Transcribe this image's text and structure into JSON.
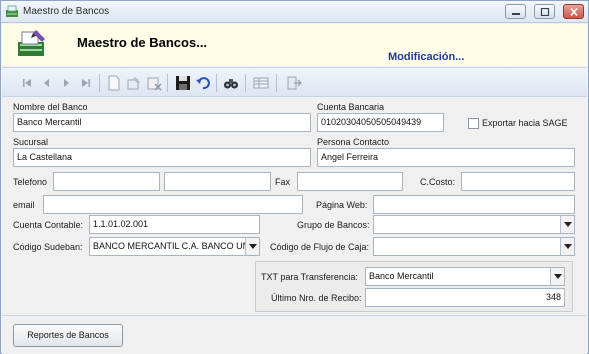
{
  "window": {
    "title": "Maestro de Bancos",
    "heading": "Maestro de Bancos...",
    "mode": "Modificación..."
  },
  "toolbar": {
    "icons": [
      "first-record-icon",
      "previous-record-icon",
      "next-record-icon",
      "last-record-icon",
      "new-record-icon",
      "edit-record-icon",
      "delete-record-icon",
      "save-icon",
      "undo-icon",
      "find-icon",
      "grid-view-icon",
      "exit-icon"
    ]
  },
  "form": {
    "nombre_banco": {
      "label": "Nombre del Banco",
      "value": "Banco Mercantil"
    },
    "cuenta_bancaria": {
      "label": "Cuenta Bancaria",
      "value": "01020304050505049439"
    },
    "exportar_sage": {
      "label": "Exportar hacia SAGE",
      "checked": false
    },
    "sucursal": {
      "label": "Sucursal",
      "value": "La Castellana"
    },
    "persona_contacto": {
      "label": "Persona Contacto",
      "value": "Angel Ferreira"
    },
    "telefono": {
      "label": "Telefono",
      "value1": "",
      "value2": ""
    },
    "fax": {
      "label": "Fax",
      "value": ""
    },
    "ccosto": {
      "label": "C.Costo:",
      "value": ""
    },
    "email": {
      "label": "email",
      "value": ""
    },
    "pagina_web": {
      "label": "Página Web:",
      "value": ""
    },
    "cuenta_contable": {
      "label": "Cuenta Contable:",
      "value": "1.1.01.02.001"
    },
    "grupo_bancos": {
      "label": "Grupo de Bancos:",
      "value": ""
    },
    "codigo_sudeban": {
      "label": "Código Sudeban:",
      "value": "BANCO MERCANTIL C.A. BANCO UNIV"
    },
    "codigo_flujo": {
      "label": "Código de Flujo de Caja:",
      "value": ""
    },
    "txt_transferencia": {
      "label": "TXT para Transferencia:",
      "value": "Banco Mercantil"
    },
    "ultimo_recibo": {
      "label": "Último Nro. de Recibo:",
      "value": "348"
    }
  },
  "footer": {
    "reportes_label": "Reportes de Bancos"
  },
  "colors": {
    "header_bg": "#fffce8",
    "mode_text": "#1f3a9a",
    "form_bg": "#f0f0f0"
  }
}
